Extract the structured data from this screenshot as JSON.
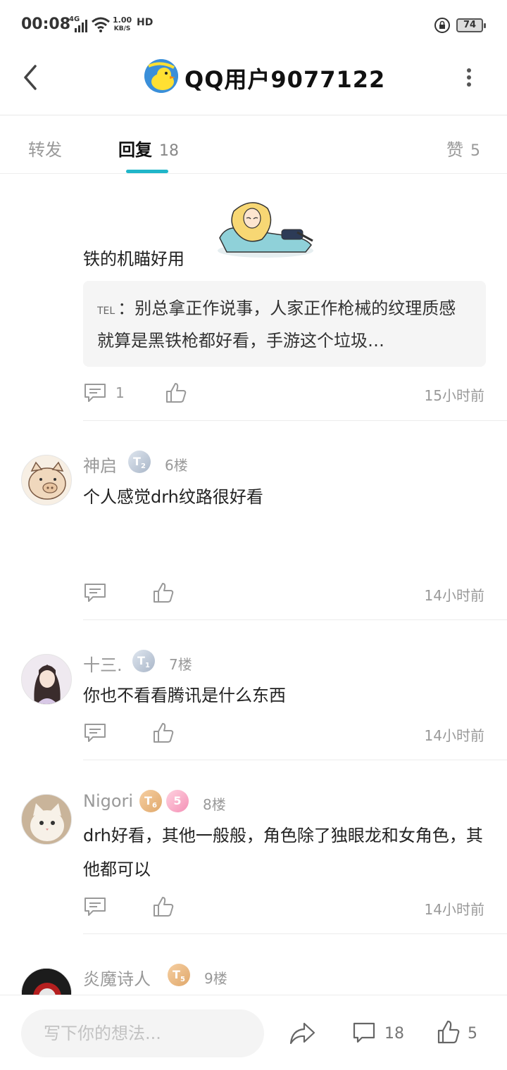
{
  "status_bar": {
    "time": "00:08",
    "network": "4G",
    "speed_value": "1.00",
    "speed_unit": "KB/S",
    "hd": "HD",
    "battery": "74"
  },
  "header": {
    "title": "QQ用户9077122"
  },
  "tabs": {
    "forward_label": "转发",
    "reply_label": "回复",
    "reply_count": "18",
    "like_label": "赞",
    "like_count": "5"
  },
  "top_comment": {
    "text": "铁的机瞄好用",
    "quote_name": "TEL",
    "quote_text": "：别总拿正作说事，人家正作枪械的纹理质感就算是黑铁枪都好看，手游这个垃圾…",
    "reply_count": "1",
    "time": "15小时前"
  },
  "comments": [
    {
      "username": "神启",
      "badge": "T",
      "badge_level": "2",
      "floor": "6楼",
      "text": "个人感觉drh纹路很好看",
      "time": "14小时前"
    },
    {
      "username": "十三.",
      "badge": "T",
      "badge_level": "1",
      "floor": "7楼",
      "text": "你也不看看腾讯是什么东西",
      "time": "14小时前"
    },
    {
      "username": "Nigori",
      "badge": "T",
      "badge_level": "6",
      "badge2": "5",
      "floor": "8楼",
      "text": "drh好看，其他一般般，角色除了独眼龙和女角色，其他都可以",
      "time": "14小时前"
    },
    {
      "username": "炎魔诗人",
      "badge": "T",
      "badge_level": "5",
      "floor": "9楼"
    }
  ],
  "bottom_bar": {
    "input_placeholder": "写下你的想法...",
    "comment_count": "18",
    "like_count": "5"
  },
  "colors": {
    "accent": "#20b6c9",
    "muted_text": "#999999",
    "quote_bg": "#f5f5f5"
  }
}
